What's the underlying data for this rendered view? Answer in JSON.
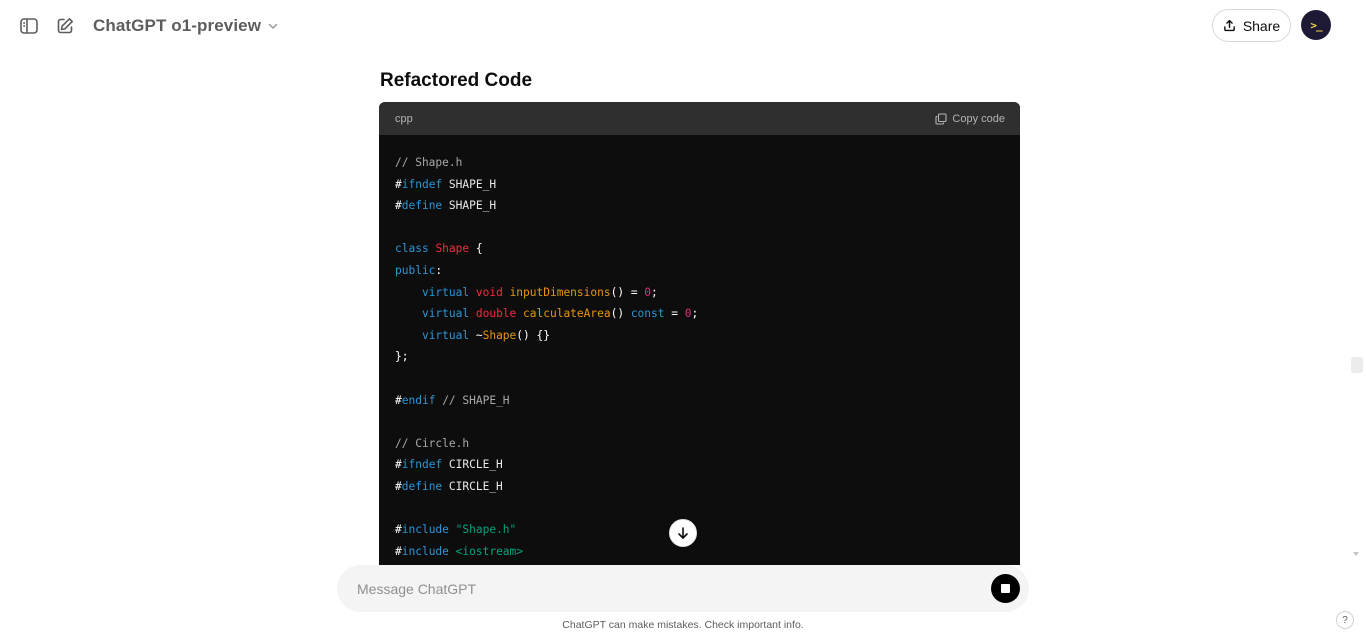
{
  "header": {
    "model_name": "ChatGPT o1-preview",
    "share_label": "Share",
    "avatar_glyph": ">_"
  },
  "icons": {
    "sidebar_toggle": "sidebar-icon",
    "new_chat": "edit-icon",
    "model_chevron": "chevron-down-icon",
    "share": "upload-icon",
    "copy": "copy-icon",
    "scroll_down": "arrow-down-icon",
    "stop": "stop-icon"
  },
  "content": {
    "heading": "Refactored Code"
  },
  "code_block": {
    "language": "cpp",
    "copy_label": "Copy code",
    "lines": [
      "// Shape.h",
      "#ifndef SHAPE_H",
      "#define SHAPE_H",
      "",
      "class Shape {",
      "public:",
      "    virtual void inputDimensions() = 0;",
      "    virtual double calculateArea() const = 0;",
      "    virtual ~Shape() {}",
      "};",
      "",
      "#endif // SHAPE_H",
      "",
      "// Circle.h",
      "#ifndef CIRCLE_H",
      "#define CIRCLE_H",
      "",
      "#include \"Shape.h\"",
      "#include <iostream>"
    ]
  },
  "composer": {
    "placeholder": "Message ChatGPT"
  },
  "footer": {
    "disclaimer": "ChatGPT can make mistakes. Check important info.",
    "help_label": "?"
  },
  "colors": {
    "code_bg": "#0d0d0d",
    "code_header_bg": "#2f2f2f",
    "keyword": "#2e95d3",
    "type": "#f22c3d",
    "function": "#e9950c",
    "number": "#df3079",
    "string": "#00a67d",
    "comment": "#a9a9a9"
  }
}
